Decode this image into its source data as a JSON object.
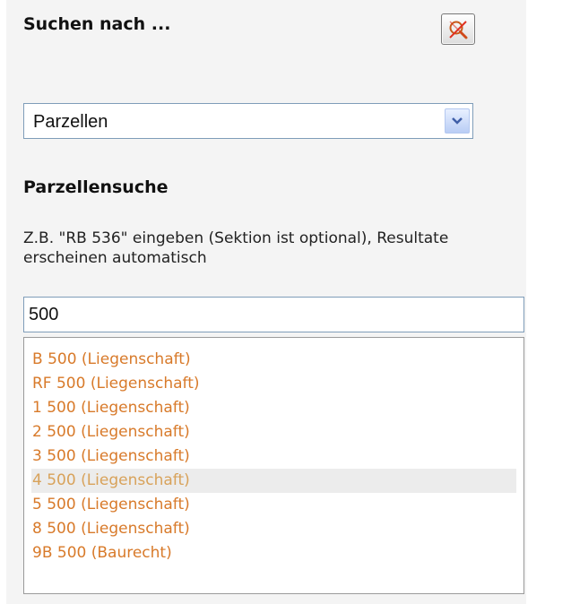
{
  "header": {
    "title": "Suchen nach ..."
  },
  "type_select": {
    "selected": "Parzellen"
  },
  "parcel_search": {
    "heading": "Parzellensuche",
    "hint": "Z.B. \"RB 536\" eingeben (Sektion ist optional), Resultate erscheinen automatisch",
    "query": "500"
  },
  "results": [
    {
      "label": "B 500 (Liegenschaft)",
      "highlighted": false
    },
    {
      "label": "RF 500 (Liegenschaft)",
      "highlighted": false
    },
    {
      "label": "1 500 (Liegenschaft)",
      "highlighted": false
    },
    {
      "label": "2 500 (Liegenschaft)",
      "highlighted": false
    },
    {
      "label": "3 500 (Liegenschaft)",
      "highlighted": false
    },
    {
      "label": "4 500 (Liegenschaft)",
      "highlighted": true
    },
    {
      "label": "5 500 (Liegenschaft)",
      "highlighted": false
    },
    {
      "label": "8 500 (Liegenschaft)",
      "highlighted": false
    },
    {
      "label": "9B 500 (Baurecht)",
      "highlighted": false
    }
  ],
  "colors": {
    "result_text": "#d87a2a",
    "result_highlight_text": "#d8a25a",
    "result_highlight_bg": "#ececec",
    "panel_bg": "#f4f4f4",
    "input_border": "#7f9db9"
  },
  "icons": {
    "clear": "magnifier-crossed-icon",
    "dropdown": "chevron-down-icon"
  }
}
